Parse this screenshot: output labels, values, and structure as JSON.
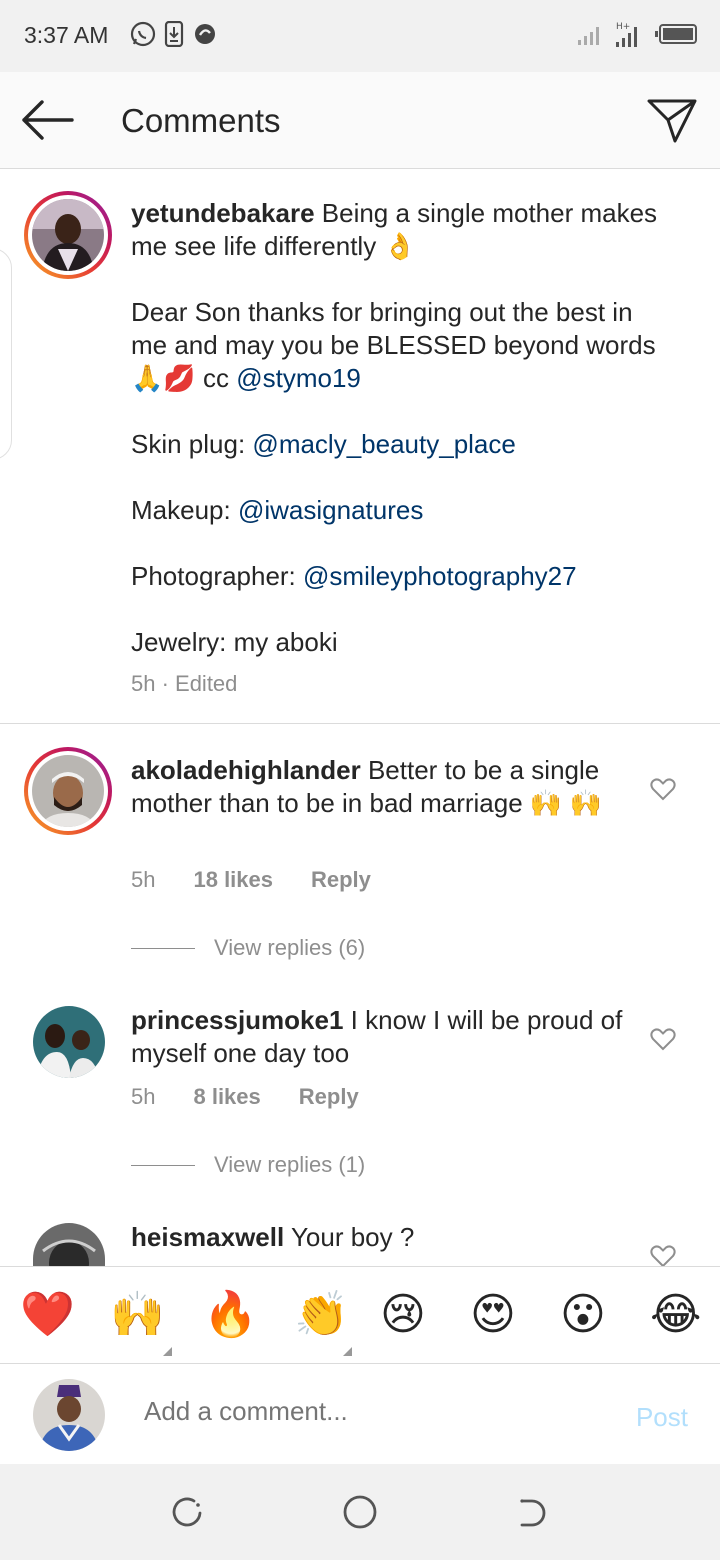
{
  "status_bar": {
    "time": "3:37 AM"
  },
  "header": {
    "title": "Comments"
  },
  "caption": {
    "username": "yetundebakare",
    "line1": "Being a single mother makes me see life differently",
    "line1_emoji": "👌",
    "line2": "Dear Son thanks for bringing out the best in me and may you be BLESSED beyond words",
    "line2_emoji": "🙏💋",
    "line2_cc": "cc",
    "line2_mention": "@stymo19",
    "skin_label": "Skin plug:",
    "skin_mention": "@macly_beauty_place",
    "makeup_label": "Makeup:",
    "makeup_mention": "@iwasignatures",
    "photo_label": "Photographer:",
    "photo_mention": "@smileyphotography27",
    "jewelry": "Jewelry: my aboki",
    "meta": "5h · Edited"
  },
  "comments": [
    {
      "username": "akoladehighlander",
      "text": "Better to be a single mother than to be in bad marriage",
      "emoji": "🙌",
      "emoji2": "🙌",
      "time": "5h",
      "likes": "18 likes",
      "reply": "Reply",
      "view_replies": "View replies (6)"
    },
    {
      "username": "princessjumoke1",
      "text": "I know I will be proud of myself one day too",
      "time": "5h",
      "likes": "8 likes",
      "reply": "Reply",
      "view_replies": "View replies (1)"
    },
    {
      "username": "heismaxwell",
      "text": "Your boy ?"
    }
  ],
  "emoji_bar": [
    "❤️",
    "🙌",
    "🔥",
    "👏",
    "😢",
    "😍",
    "😮",
    "😂"
  ],
  "comment_input": {
    "placeholder": "Add a comment...",
    "post_label": "Post"
  },
  "colors": {
    "mention": "#003569",
    "meta": "#8e8e8e",
    "post_disabled": "#b2dffc"
  }
}
